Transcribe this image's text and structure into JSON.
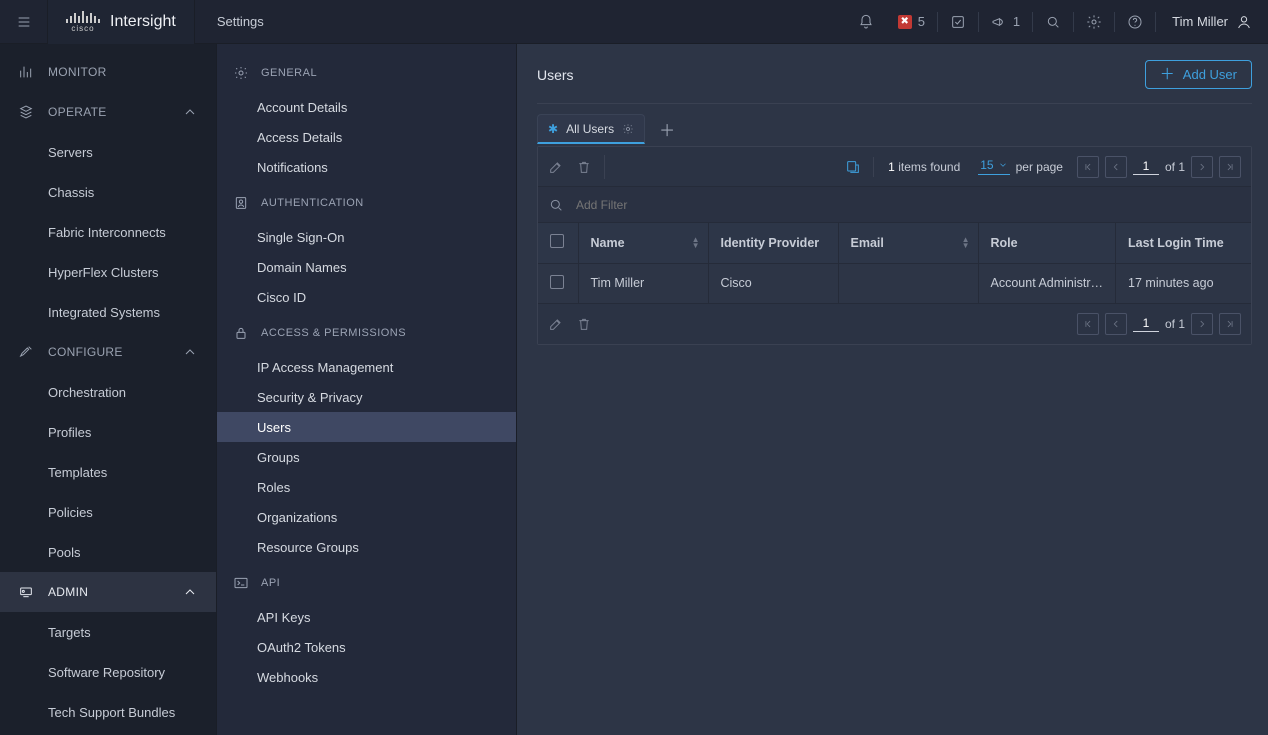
{
  "brand": {
    "cisco": "cisco",
    "product": "Intersight"
  },
  "top_page": "Settings",
  "top": {
    "alerts_count": "5",
    "announce_count": "1",
    "user": "Tim Miller"
  },
  "nav": {
    "sections": [
      {
        "key": "monitor",
        "label": "MONITOR",
        "items": [],
        "expanded": false,
        "active": false
      },
      {
        "key": "operate",
        "label": "OPERATE",
        "expanded": true,
        "active": false,
        "items": [
          {
            "label": "Servers"
          },
          {
            "label": "Chassis"
          },
          {
            "label": "Fabric Interconnects"
          },
          {
            "label": "HyperFlex Clusters"
          },
          {
            "label": "Integrated Systems"
          }
        ]
      },
      {
        "key": "configure",
        "label": "CONFIGURE",
        "expanded": true,
        "active": false,
        "items": [
          {
            "label": "Orchestration"
          },
          {
            "label": "Profiles"
          },
          {
            "label": "Templates"
          },
          {
            "label": "Policies"
          },
          {
            "label": "Pools"
          }
        ]
      },
      {
        "key": "admin",
        "label": "ADMIN",
        "expanded": true,
        "active": true,
        "items": [
          {
            "label": "Targets"
          },
          {
            "label": "Software Repository"
          },
          {
            "label": "Tech Support Bundles"
          }
        ]
      }
    ]
  },
  "settings": {
    "groups": [
      {
        "label": "GENERAL",
        "icon": "gear",
        "items": [
          {
            "label": "Account Details"
          },
          {
            "label": "Access Details"
          },
          {
            "label": "Notifications"
          }
        ]
      },
      {
        "label": "AUTHENTICATION",
        "icon": "person-auth",
        "items": [
          {
            "label": "Single Sign-On"
          },
          {
            "label": "Domain Names"
          },
          {
            "label": "Cisco ID"
          }
        ]
      },
      {
        "label": "ACCESS & PERMISSIONS",
        "icon": "lock",
        "items": [
          {
            "label": "IP Access Management"
          },
          {
            "label": "Security & Privacy"
          },
          {
            "label": "Users",
            "selected": true
          },
          {
            "label": "Groups"
          },
          {
            "label": "Roles"
          },
          {
            "label": "Organizations"
          },
          {
            "label": "Resource Groups"
          }
        ]
      },
      {
        "label": "API",
        "icon": "terminal",
        "items": [
          {
            "label": "API Keys"
          },
          {
            "label": "OAuth2 Tokens"
          },
          {
            "label": "Webhooks"
          }
        ]
      }
    ]
  },
  "page": {
    "title": "Users",
    "add_button": "Add User",
    "tab_label": "All Users",
    "filter_placeholder": "Add Filter",
    "items_found_num": "1",
    "items_found_text": "items found",
    "per_page_value": "15",
    "per_page_text": "per page",
    "page_current": "1",
    "page_total": "of 1",
    "columns": [
      "Name",
      "Identity Provider",
      "Email",
      "Role",
      "Last Login Time"
    ],
    "rows": [
      {
        "name": "Tim Miller",
        "idp": "Cisco",
        "email": "",
        "role": "Account Administr…",
        "last_login": "17 minutes ago"
      }
    ]
  }
}
